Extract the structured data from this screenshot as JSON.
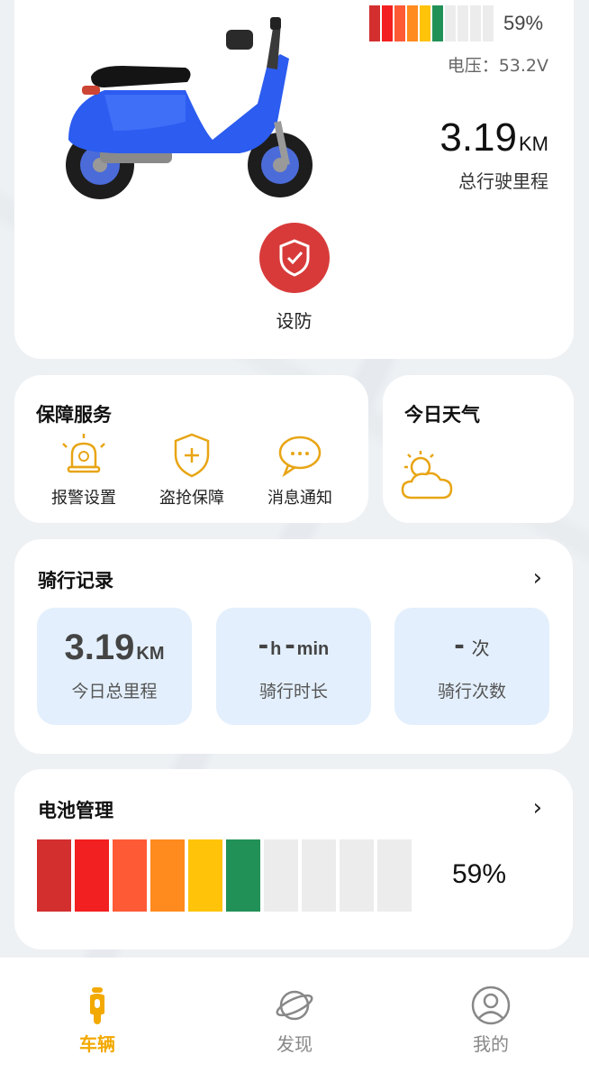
{
  "vehicle": {
    "battery_percent_text": "59%",
    "battery_level": 0.59,
    "voltage_text": "电压：53.2V",
    "total_mileage_value": "3.19",
    "total_mileage_unit": "KM",
    "total_mileage_label": "总行驶里程",
    "arm_label": "设防"
  },
  "service": {
    "title": "保障服务",
    "items": [
      {
        "label": "报警设置",
        "icon": "alarm-bell-icon"
      },
      {
        "label": "盗抢保障",
        "icon": "shield-plus-icon"
      },
      {
        "label": "消息通知",
        "icon": "chat-bubble-icon"
      }
    ]
  },
  "weather": {
    "title": "今日天气",
    "icon": "partly-cloudy-icon"
  },
  "ride_record": {
    "title": "骑行记录",
    "stats": [
      {
        "value": "3.19",
        "unit": "KM",
        "label": "今日总里程"
      },
      {
        "value_h": "-",
        "unit_h": "h",
        "value_m": "-",
        "unit_m": "min",
        "label": "骑行时长"
      },
      {
        "value": "-",
        "unit": "次",
        "label": "骑行次数"
      }
    ]
  },
  "battery": {
    "title": "电池管理",
    "percent_text": "59%",
    "segments_total": 10,
    "segments_filled": 6,
    "segment_colors": [
      "#d32f2f",
      "#f22020",
      "#ff5a36",
      "#ff8a1e",
      "#ffc30a",
      "#229157"
    ],
    "empty_color": "#ececec"
  },
  "nav": {
    "items": [
      {
        "label": "车辆",
        "active": true
      },
      {
        "label": "发现",
        "active": false
      },
      {
        "label": "我的",
        "active": false
      }
    ],
    "active_color": "#f2a900",
    "inactive_color": "#888888"
  }
}
